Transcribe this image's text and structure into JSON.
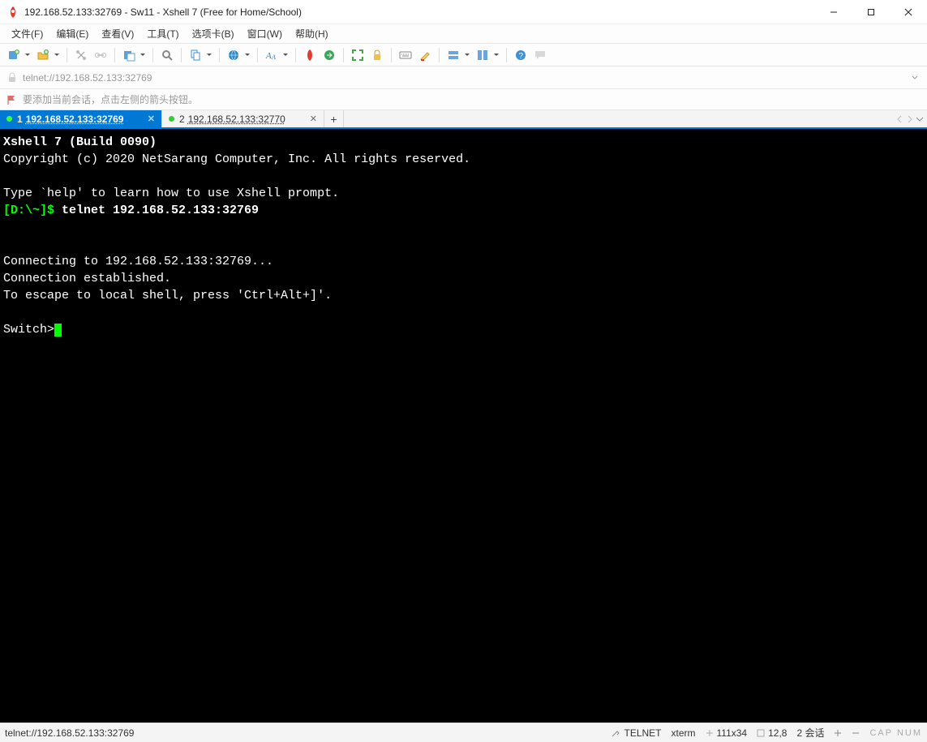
{
  "window": {
    "title": "192.168.52.133:32769 - Sw11 - Xshell 7 (Free for Home/School)"
  },
  "menubar": {
    "items": [
      "文件(F)",
      "编辑(E)",
      "查看(V)",
      "工具(T)",
      "选项卡(B)",
      "窗口(W)",
      "帮助(H)"
    ]
  },
  "addrbar": {
    "url": "telnet://192.168.52.133:32769"
  },
  "hintbar": {
    "text": "要添加当前会话，点击左侧的箭头按钮。"
  },
  "tabs": {
    "items": [
      {
        "prefix": "1",
        "label": "192.168.52.133:32769",
        "active": true
      },
      {
        "prefix": "2",
        "label": "192.168.52.133:32770",
        "active": false
      }
    ]
  },
  "terminal": {
    "lines": [
      {
        "text": "Xshell 7 (Build 0090)",
        "bold": true
      },
      {
        "text": "Copyright (c) 2020 NetSarang Computer, Inc. All rights reserved."
      },
      {
        "text": ""
      },
      {
        "text": "Type `help' to learn how to use Xshell prompt."
      },
      {
        "prompt": "[D:\\~]$ ",
        "cmd": "telnet 192.168.52.133:32769"
      },
      {
        "text": ""
      },
      {
        "text": ""
      },
      {
        "text": "Connecting to 192.168.52.133:32769..."
      },
      {
        "text": "Connection established."
      },
      {
        "text": "To escape to local shell, press 'Ctrl+Alt+]'."
      },
      {
        "text": ""
      },
      {
        "text": "Switch>",
        "cursor": true
      }
    ]
  },
  "statusbar": {
    "left": "telnet://192.168.52.133:32769",
    "protocol": "TELNET",
    "term": "xterm",
    "size": "111x34",
    "pos": "12,8",
    "sessions": "2 会话",
    "indicators": "CAP  NUM"
  }
}
